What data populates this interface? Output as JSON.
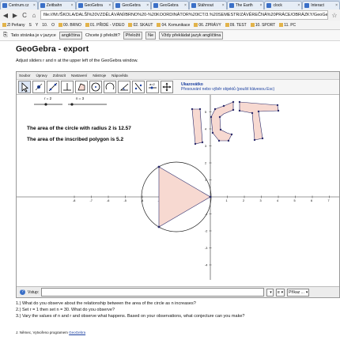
{
  "tabs": [
    {
      "label": "Centrum.cz"
    },
    {
      "label": "Zeitbahn"
    },
    {
      "label": "GeoGebra"
    },
    {
      "label": "GeoGebra"
    },
    {
      "label": "GeoGebra"
    },
    {
      "label": "Stáhnout"
    },
    {
      "label": "The Earth"
    },
    {
      "label": "clock"
    },
    {
      "label": "Interact"
    }
  ],
  "nav": {
    "back": "◀",
    "forward": "▶",
    "reload": "C",
    "home": "⌂"
  },
  "url": "file:///M:/ŠKOLA/DALŠÍ%20VZDĚLÁVÁNÍ/BRNO%20-%20KOORDINÁTOR%20ICT/3.%20SEMESTR/ZÁVĚREČNÁ%20PRÁCE/OBRÁZKY/GeoGe",
  "bookmarks": [
    "Zl Peňany",
    "S",
    "Y",
    "10.",
    "O",
    "00. BRNO",
    "01. PŘIDÉ - VIDEO",
    "02. SKAUT",
    "04. Komunikace",
    "06. ZPRÁVY",
    "09. TEST",
    "10. SPORT",
    "11. PC",
    "12."
  ],
  "translate": {
    "prefix": "Tato stránka je v jazyce",
    "language": "angličtina",
    "question": "Chcete ji přeložit?",
    "translate_btn": "Přeložit",
    "no_btn": "Ne",
    "always_btn": "Vždy překládat jazyk angličtina"
  },
  "page": {
    "title": "GeoGebra - export",
    "subtitle": "Adjust sliders r and n at the upper left of the GeoGebra window."
  },
  "geogebra": {
    "menu": [
      "Soubor",
      "Úpravy",
      "Zobrazit",
      "Nastavení",
      "Nástroje",
      "Nápověda"
    ],
    "hint_title": "Ukazovátko",
    "hint_text": "Přesouvání nebo výběr objektů (pouští klávesou Esc)",
    "slider_r_label": "r = 2",
    "slider_n_label": "n = 3",
    "circle_text": "The area of the circle with radius 2 is 12.57",
    "polygon_text": "The area of the inscribed polygon is 5.2",
    "x_ticks": [
      "-8",
      "-7",
      "-6",
      "-5",
      "-4",
      "-3",
      "-2",
      "-1",
      "1",
      "2",
      "3",
      "4",
      "5",
      "6",
      "7",
      "8",
      "9"
    ],
    "y_ticks": [
      "5",
      "4",
      "3",
      "2",
      "1",
      "-1",
      "-2",
      "-3",
      "-4",
      "-5",
      "-6"
    ],
    "input_label": "Vstup:",
    "input_value": "",
    "select1": "",
    "select2": "α",
    "select3": "Příkaz ..."
  },
  "questions": [
    "1.) What do you observe about the relationship between the area of the circle as n increases?",
    "2.) Set r = 1 then set n = 30. What do you observe?",
    "3.) Vary the values of n and r and observe what happens. Based on your observations, what conjecture can you make?"
  ],
  "footer": {
    "author": "J. Němec, Vytvořeno programem",
    "link": "GeoGebra"
  },
  "colors": {
    "accent": "#1a3fa0",
    "shape_fill": "#f7d9d1",
    "shape_stroke": "#2a2a6a"
  }
}
